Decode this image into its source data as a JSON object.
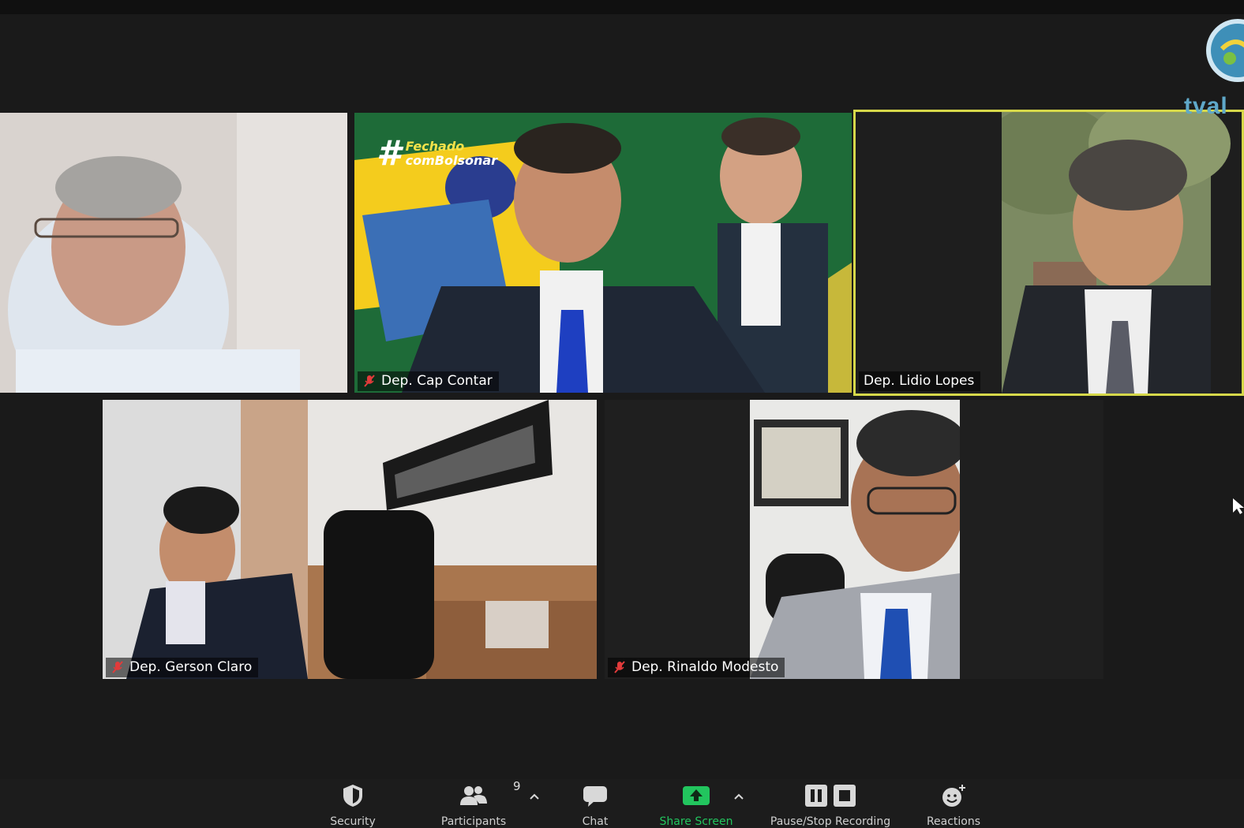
{
  "participants": [
    {
      "name": ""
    },
    {
      "name": "Dep. Cap Contar",
      "muted": true,
      "background_text": [
        "Fechado",
        "comBolsonar"
      ]
    },
    {
      "name": "Dep. Lidio Lopes",
      "active_speaker": true
    },
    {
      "name": "Dep. Gerson Claro",
      "muted": true
    },
    {
      "name": "Dep. Rinaldo Modesto",
      "muted": true
    }
  ],
  "toolbar": {
    "security": "Security",
    "participants": "Participants",
    "participants_count": "9",
    "chat": "Chat",
    "share_screen": "Share Screen",
    "recording": "Pause/Stop Recording",
    "reactions": "Reactions"
  },
  "logo": {
    "text": "tval"
  },
  "colors": {
    "active_speaker_border": "#d6d84a",
    "share_green": "#22c55e",
    "mute_red": "#e23b3b"
  },
  "icons": [
    "shield-icon",
    "participants-icon",
    "chat-icon",
    "share-screen-icon",
    "pause-icon",
    "stop-icon",
    "reactions-icon",
    "mic-muted-icon"
  ]
}
